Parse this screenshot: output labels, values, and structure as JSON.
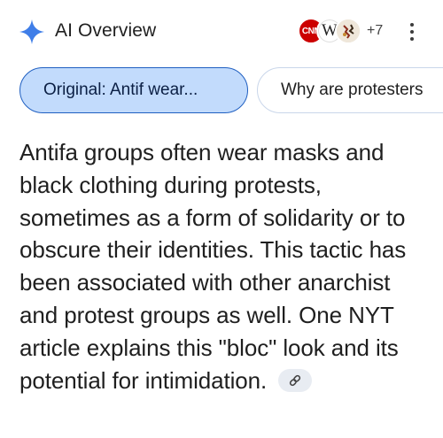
{
  "header": {
    "title": "AI Overview",
    "sparkle_color": "#4285f4",
    "sources": [
      {
        "name": "CNN",
        "icon": "cnn-logo"
      },
      {
        "name": "W",
        "icon": "wikipedia-logo"
      },
      {
        "name": "",
        "icon": "source-thumbnail"
      }
    ],
    "more_sources": "+7",
    "menu_icon": "more-vert-icon"
  },
  "chips": [
    {
      "label": "Original: Antif wear...",
      "active": true
    },
    {
      "label": "Why are protesters",
      "active": false
    }
  ],
  "body": {
    "text": "Antifa groups often wear masks and black clothing during protests, sometimes as a form of solidarity or to obscure their identities. This tactic has been associated with other anarchist and protest groups as well. One NYT article explains this \"bloc\" look and its potential for intimidation.",
    "link_icon": "link-icon"
  }
}
